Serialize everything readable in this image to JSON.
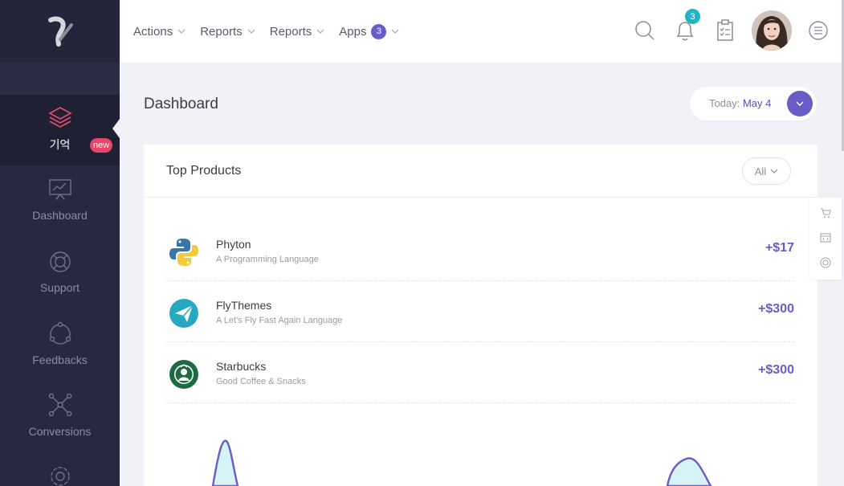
{
  "sidebar": {
    "items": [
      {
        "label": "기억",
        "icon": "layers-icon",
        "badge": "new",
        "active": true
      },
      {
        "label": "Dashboard",
        "icon": "chart-board-icon"
      },
      {
        "label": "Support",
        "icon": "lifebuoy-icon"
      },
      {
        "label": "Feedbacks",
        "icon": "feedback-cycle-icon"
      },
      {
        "label": "Conversions",
        "icon": "network-icon"
      },
      {
        "label": "",
        "icon": "gear-icon"
      }
    ]
  },
  "header": {
    "nav": [
      {
        "label": "Actions"
      },
      {
        "label": "Reports"
      },
      {
        "label": "Reports"
      },
      {
        "label": "Apps",
        "badge": "3"
      }
    ],
    "notifications_count": "3",
    "icons": [
      "search-icon",
      "bell-icon",
      "clipboard-icon",
      "menu-icon"
    ]
  },
  "page": {
    "title": "Dashboard",
    "today_label": "Today:",
    "today_value": "May 4"
  },
  "card": {
    "title": "Top Products",
    "filter": "All",
    "products": [
      {
        "name": "Phyton",
        "subtitle": "A Programming Language",
        "value": "+$17",
        "logo": "python-logo"
      },
      {
        "name": "FlyThemes",
        "subtitle": "A Let's Fly Fast Again Language",
        "value": "+$300",
        "logo": "paper-plane-logo"
      },
      {
        "name": "Starbucks",
        "subtitle": "Good Coffee & Snacks",
        "value": "+$300",
        "logo": "starbucks-logo"
      }
    ]
  },
  "colors": {
    "sidebar": "#272940",
    "accent": "#6a5cc7",
    "badge_new": "#e8456b",
    "bell_badge": "#1fb5c7"
  }
}
